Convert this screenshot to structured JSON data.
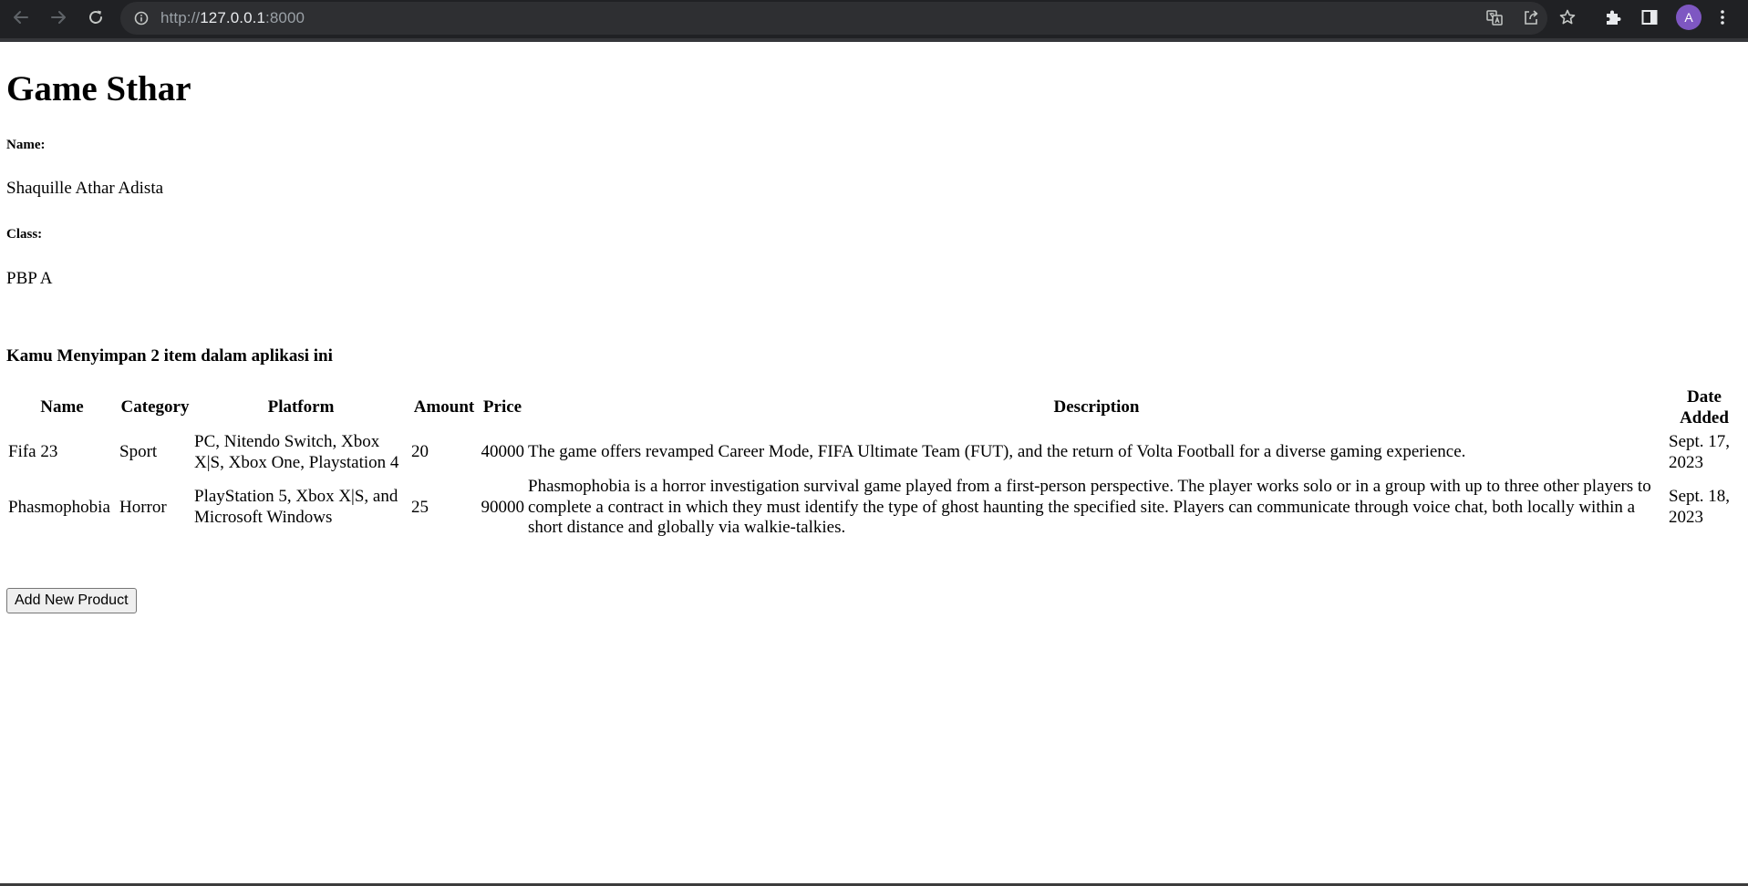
{
  "browser": {
    "url_scheme": "http://",
    "url_host": "127.0.0.1",
    "url_port": ":8000",
    "profile_initial": "A",
    "icons": {
      "back": "back-arrow-icon",
      "forward": "forward-arrow-icon",
      "reload": "reload-icon",
      "site_info": "info-icon",
      "translate": "translate-icon",
      "share": "share-icon",
      "bookmark": "star-icon",
      "extensions": "puzzle-icon",
      "side_panel": "side-panel-icon",
      "menu": "kebab-menu-icon"
    },
    "colors": {
      "frame": "#202124",
      "omnibox": "#2e2f32",
      "avatar": "#7e57c2"
    }
  },
  "page": {
    "title": "Game Sthar",
    "name_label": "Name:",
    "name_value": "Shaquille Athar Adista",
    "class_label": "Class:",
    "class_value": "PBP A",
    "summary": "Kamu Menyimpan 2 item dalam aplikasi ini",
    "add_button": "Add New Product"
  },
  "table": {
    "headers": {
      "name": "Name",
      "category": "Category",
      "platform": "Platform",
      "amount": "Amount",
      "price": "Price",
      "description": "Description",
      "date_added": "Date Added"
    },
    "rows": [
      {
        "name": "Fifa 23",
        "category": "Sport",
        "platform": "PC, Nitendo Switch, Xbox X|S, Xbox One, Playstation 4",
        "amount": "20",
        "price": "40000",
        "description": "The game offers revamped Career Mode, FIFA Ultimate Team (FUT), and the return of Volta Football for a diverse gaming experience.",
        "date_added": "Sept. 17, 2023"
      },
      {
        "name": "Phasmophobia",
        "category": "Horror",
        "platform": "PlayStation 5, Xbox X|S, and Microsoft Windows",
        "amount": "25",
        "price": "90000",
        "description": "Phasmophobia is a horror investigation survival game played from a first-person perspective. The player works solo or in a group with up to three other players to complete a contract in which they must identify the type of ghost haunting the specified site. Players can communicate through voice chat, both locally within a short distance and globally via walkie-talkies.",
        "date_added": "Sept. 18, 2023"
      }
    ]
  }
}
